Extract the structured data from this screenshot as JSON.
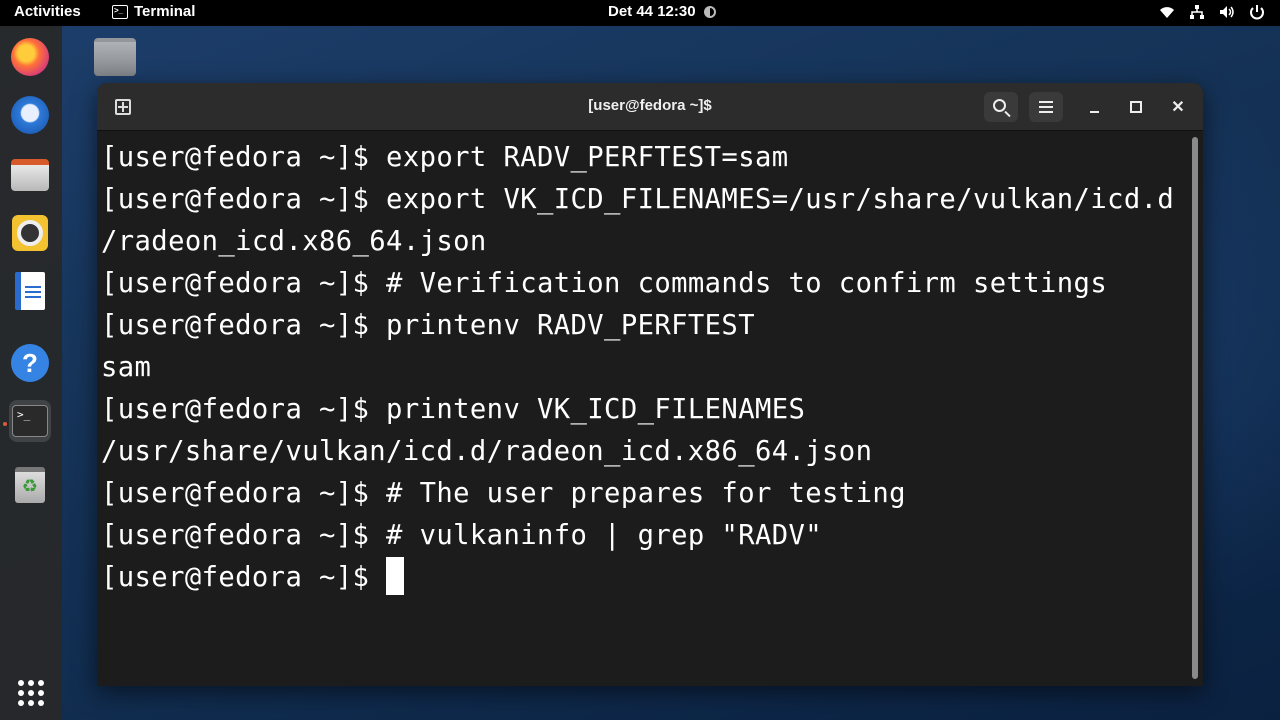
{
  "topbar": {
    "activities": "Activities",
    "app_name": "Terminal",
    "clock": "Det 44 12:30",
    "tray_icons": [
      "wifi-icon",
      "network-icon",
      "volume-icon",
      "power-icon"
    ]
  },
  "dash": {
    "apps": [
      "firefox",
      "thunderbird",
      "files",
      "rhythmbox",
      "libreoffice-writer",
      "help",
      "terminal",
      "trash"
    ],
    "active_app": "terminal"
  },
  "window": {
    "title": "[user@fedora ~]$",
    "lines": [
      "[user@fedora ~]$ export RADV_PERFTEST=sam",
      "[user@fedora ~]$ export VK_ICD_FILENAMES=/usr/share/vulkan/icd.d",
      "/radeon_icd.x86_64.json",
      "[user@fedora ~]$ # Verification commands to confirm settings",
      "[user@fedora ~]$ printenv RADV_PERFTEST",
      "sam",
      "[user@fedora ~]$ printenv VK_ICD_FILENAMES",
      "/usr/share/vulkan/icd.d/radeon_icd.x86_64.json",
      "[user@fedora ~]$ # The user prepares for testing",
      "[user@fedora ~]$ # vulkaninfo | grep \"RADV\"",
      "[user@fedora ~]$ "
    ]
  },
  "colors": {
    "terminal_bg": "#1c1c1c",
    "terminal_fg": "#ffffff",
    "headerbar": "#2c2c2c",
    "topbar": "#000000"
  }
}
